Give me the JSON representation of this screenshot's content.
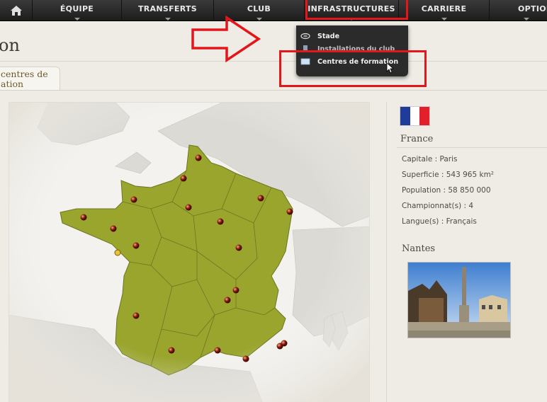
{
  "nav": {
    "items": [
      {
        "label": "ÉQUIPE"
      },
      {
        "label": "TRANSFERTS"
      },
      {
        "label": "CLUB"
      },
      {
        "label": "INFRASTRUCTURES"
      },
      {
        "label": "CARRIERE"
      },
      {
        "label": "OPTION"
      }
    ]
  },
  "dropdown": {
    "items": [
      {
        "label": "Stade",
        "icon": "stadium-icon"
      },
      {
        "label": "Installations du club",
        "icon": "building-icon"
      },
      {
        "label": "Centres de formation",
        "icon": "map-icon"
      }
    ]
  },
  "page": {
    "title": "on",
    "tab_label_1": "centres de",
    "tab_label_2": "ation"
  },
  "country": {
    "name": "France",
    "capitale": "Capitale : Paris",
    "superficie": "Superficie : 543 965 km²",
    "population": "Population : 58 850 000",
    "championnats": "Championnat(s) : 4",
    "langues": "Langue(s) : Français"
  },
  "city": {
    "name": "Nantes"
  },
  "colors": {
    "highlight": "#e3161b",
    "map_fill": "#9aa52e",
    "flag_blue": "#1f3c9a",
    "flag_red": "#e21f2b"
  }
}
